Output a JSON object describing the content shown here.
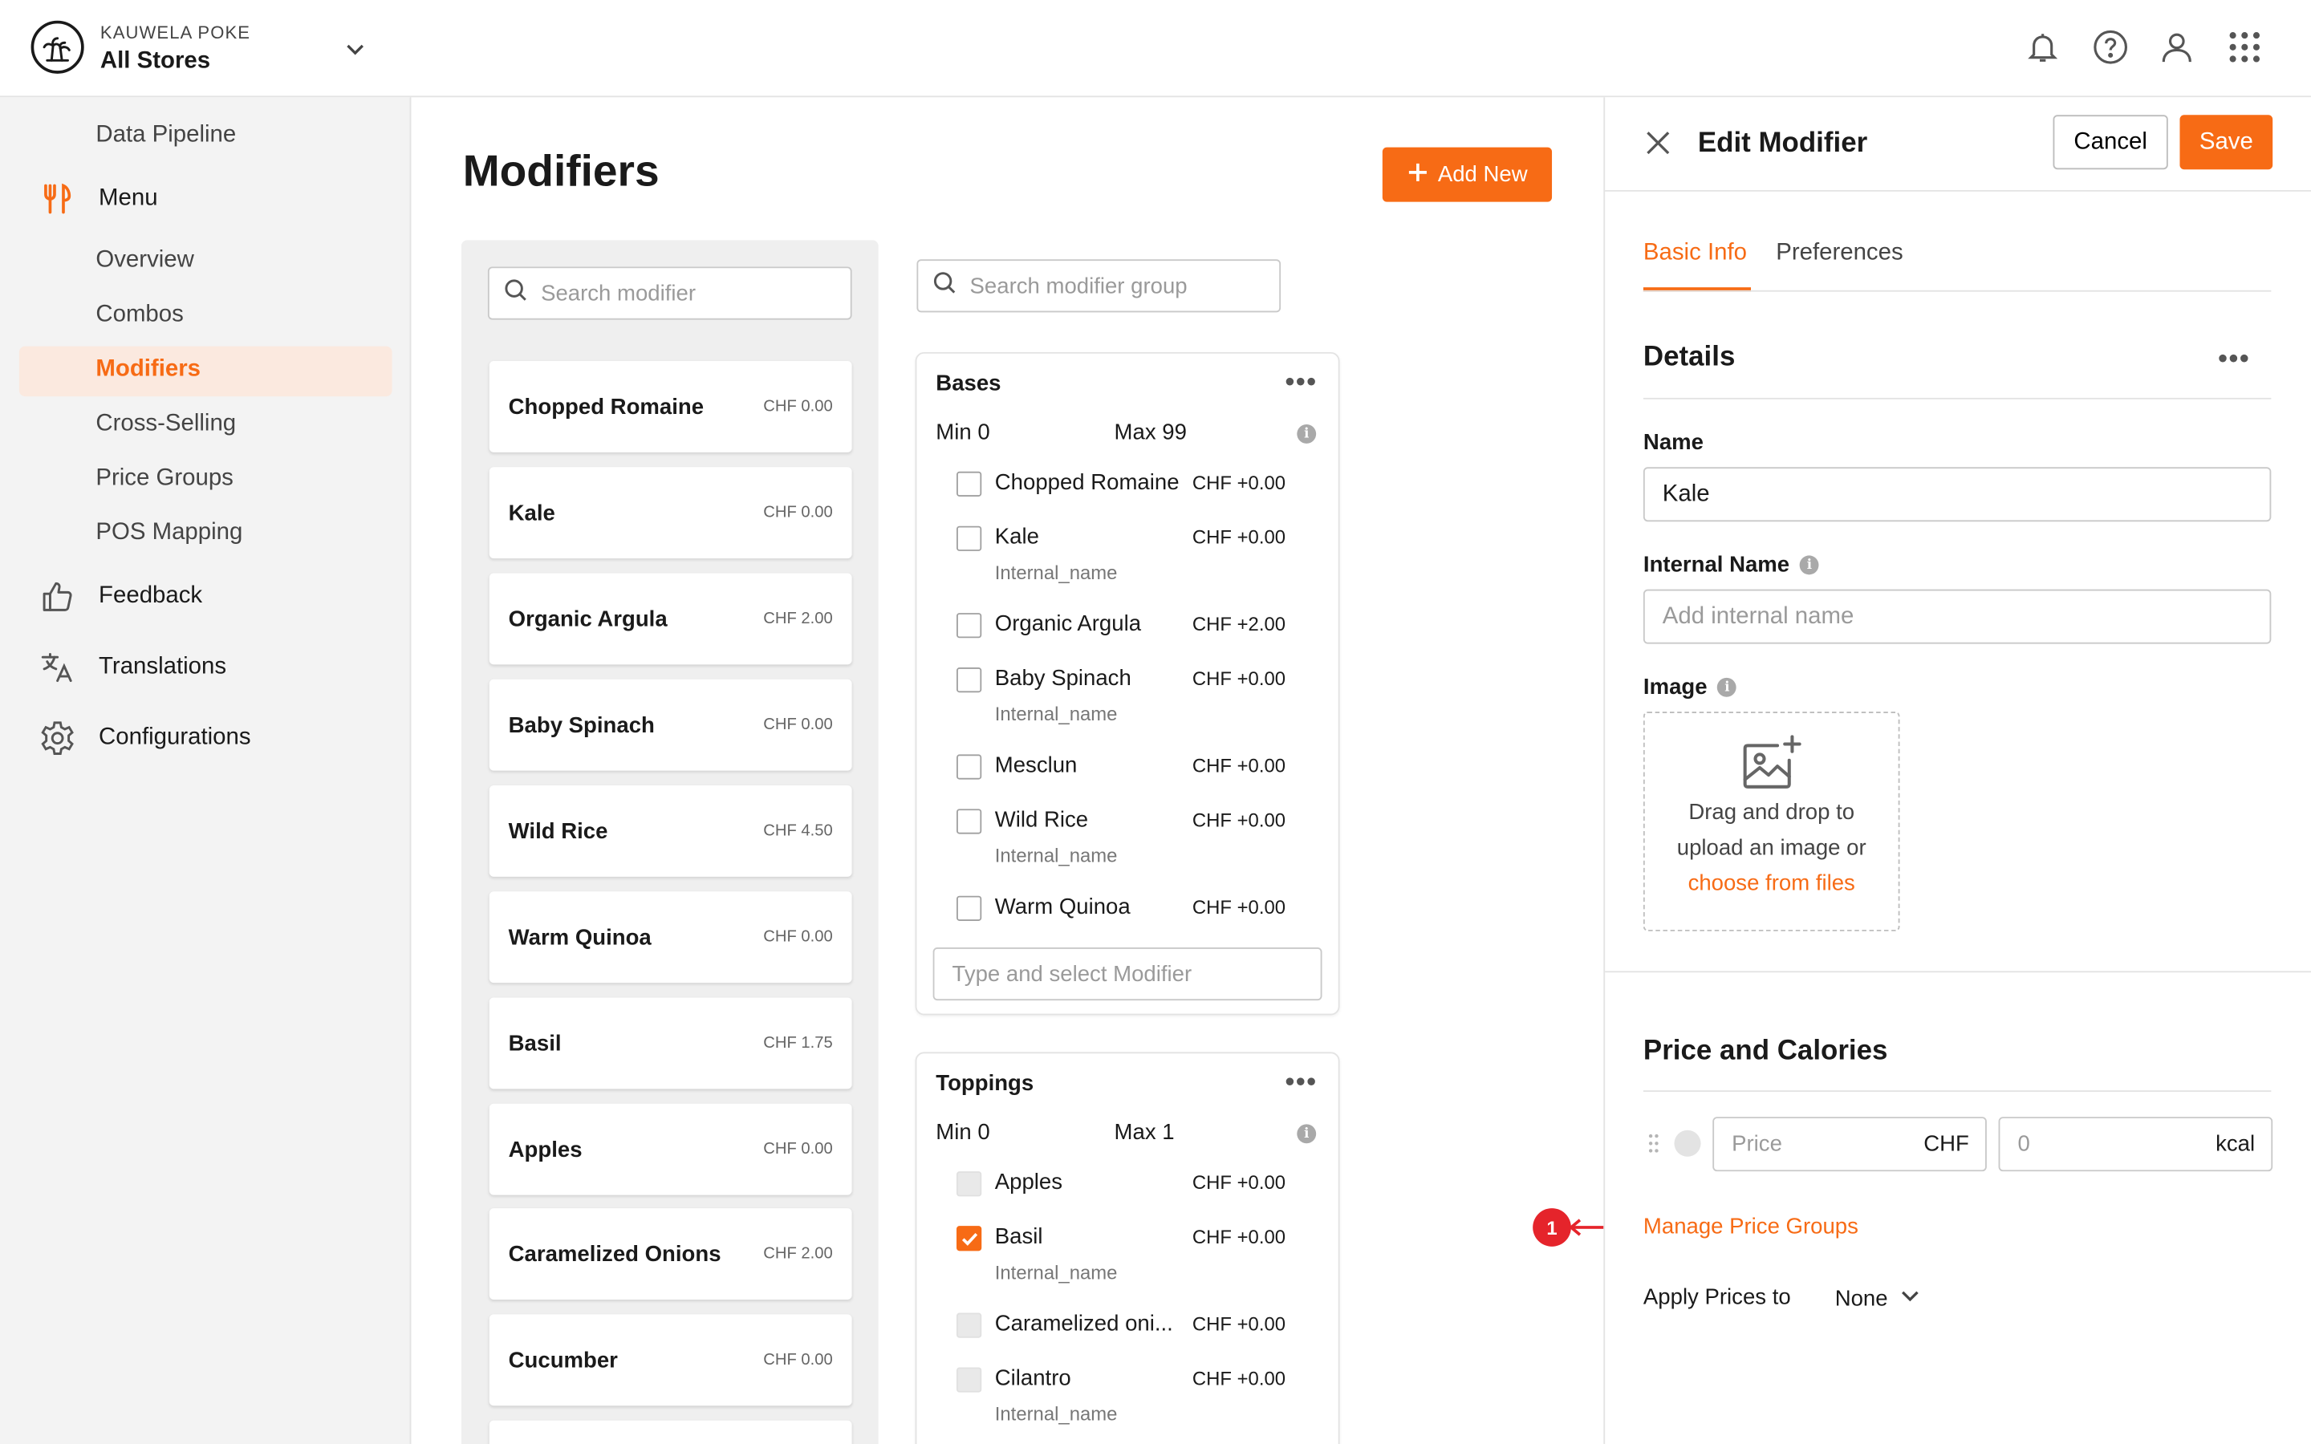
{
  "header": {
    "brand": "KAUWELA POKE",
    "store": "All Stores",
    "icons": [
      "bell-icon",
      "help-icon",
      "user-icon",
      "apps-grid-icon"
    ]
  },
  "sidebar": {
    "data_pipeline": "Data Pipeline",
    "menu": "Menu",
    "menu_items": [
      "Overview",
      "Combos",
      "Modifiers",
      "Cross-Selling",
      "Price Groups",
      "POS Mapping"
    ],
    "active": "Modifiers",
    "feedback": "Feedback",
    "translations": "Translations",
    "configurations": "Configurations"
  },
  "main": {
    "title": "Modifiers",
    "add_new": "Add New",
    "search_modifier_placeholder": "Search modifier",
    "search_group_placeholder": "Search modifier group",
    "modifiers": [
      {
        "name": "Chopped Romaine",
        "price": "CHF 0.00"
      },
      {
        "name": "Kale",
        "price": "CHF 0.00"
      },
      {
        "name": "Organic Argula",
        "price": "CHF 2.00"
      },
      {
        "name": "Baby Spinach",
        "price": "CHF 0.00"
      },
      {
        "name": "Wild Rice",
        "price": "CHF 4.50"
      },
      {
        "name": "Warm Quinoa",
        "price": "CHF 0.00"
      },
      {
        "name": "Basil",
        "price": "CHF 1.75"
      },
      {
        "name": "Apples",
        "price": "CHF 0.00"
      },
      {
        "name": "Caramelized Onions",
        "price": "CHF 2.00"
      },
      {
        "name": "Cucumber",
        "price": "CHF 0.00"
      }
    ],
    "groups": {
      "bases": {
        "title": "Bases",
        "min": "Min 0",
        "max": "Max 99",
        "items": [
          {
            "label": "Chopped Romaine",
            "price": "CHF +0.00",
            "internal": ""
          },
          {
            "label": "Kale",
            "price": "CHF +0.00",
            "internal": "Internal_name"
          },
          {
            "label": "Organic Argula",
            "price": "CHF +2.00",
            "internal": ""
          },
          {
            "label": "Baby Spinach",
            "price": "CHF +0.00",
            "internal": "Internal_name"
          },
          {
            "label": "Mesclun",
            "price": "CHF +0.00",
            "internal": ""
          },
          {
            "label": "Wild Rice",
            "price": "CHF +0.00",
            "internal": "Internal_name"
          },
          {
            "label": "Warm Quinoa",
            "price": "CHF +0.00",
            "internal": ""
          }
        ],
        "type_placeholder": "Type and select Modifier"
      },
      "toppings": {
        "title": "Toppings",
        "min": "Min 0",
        "max": "Max 1",
        "items": [
          {
            "label": "Apples",
            "price": "CHF +0.00",
            "internal": ""
          },
          {
            "label": "Basil",
            "price": "CHF +0.00",
            "internal": "Internal_name",
            "checked": true
          },
          {
            "label": "Caramelized oni...",
            "price": "CHF +0.00",
            "internal": ""
          },
          {
            "label": "Cilantro",
            "price": "CHF +0.00",
            "internal": "Internal_name"
          }
        ]
      }
    }
  },
  "editor": {
    "title": "Edit Modifier",
    "cancel": "Cancel",
    "save": "Save",
    "tabs": [
      "Basic Info",
      "Preferences"
    ],
    "active_tab": "Basic Info",
    "details": "Details",
    "name_label": "Name",
    "name_value": "Kale",
    "internal_label": "Internal Name",
    "internal_placeholder": "Add internal name",
    "image_label": "Image",
    "upload_line1": "Drag and drop to",
    "upload_line2": "upload an image or",
    "upload_link": "choose from files",
    "price_section": "Price and Calories",
    "price_placeholder": "Price",
    "price_unit": "CHF",
    "kcal_placeholder": "0",
    "kcal_unit": "kcal",
    "manage_link": "Manage Price Groups",
    "apply_label": "Apply Prices to",
    "apply_value": "None"
  },
  "annotation": {
    "badge": "1",
    "color": "#e5242b"
  },
  "colors": {
    "accent": "#f76b15",
    "active_bg": "#fbe9df"
  }
}
